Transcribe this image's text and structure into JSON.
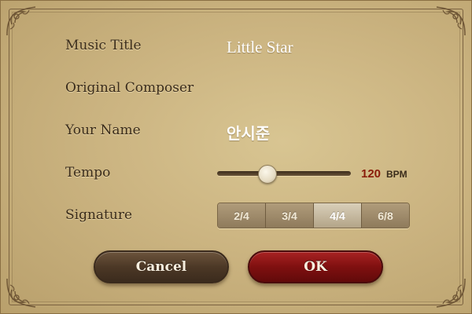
{
  "form": {
    "music_title": {
      "label": "Music Title",
      "value": "Little Star"
    },
    "original_composer": {
      "label": "Original Composer",
      "value": ""
    },
    "your_name": {
      "label": "Your Name",
      "value": "안시준"
    },
    "tempo": {
      "label": "Tempo",
      "value": "120",
      "unit": "BPM",
      "slider_fraction": 0.37
    },
    "signature": {
      "label": "Signature",
      "options": [
        "2/4",
        "3/4",
        "4/4",
        "6/8"
      ],
      "selected": "4/4"
    }
  },
  "buttons": {
    "cancel": "Cancel",
    "ok": "OK"
  },
  "colors": {
    "ok": "#8b1111",
    "cancel": "#4a3624",
    "tempo_value": "#8a1c0a"
  },
  "icons": [
    "corner-ornament-icon"
  ]
}
